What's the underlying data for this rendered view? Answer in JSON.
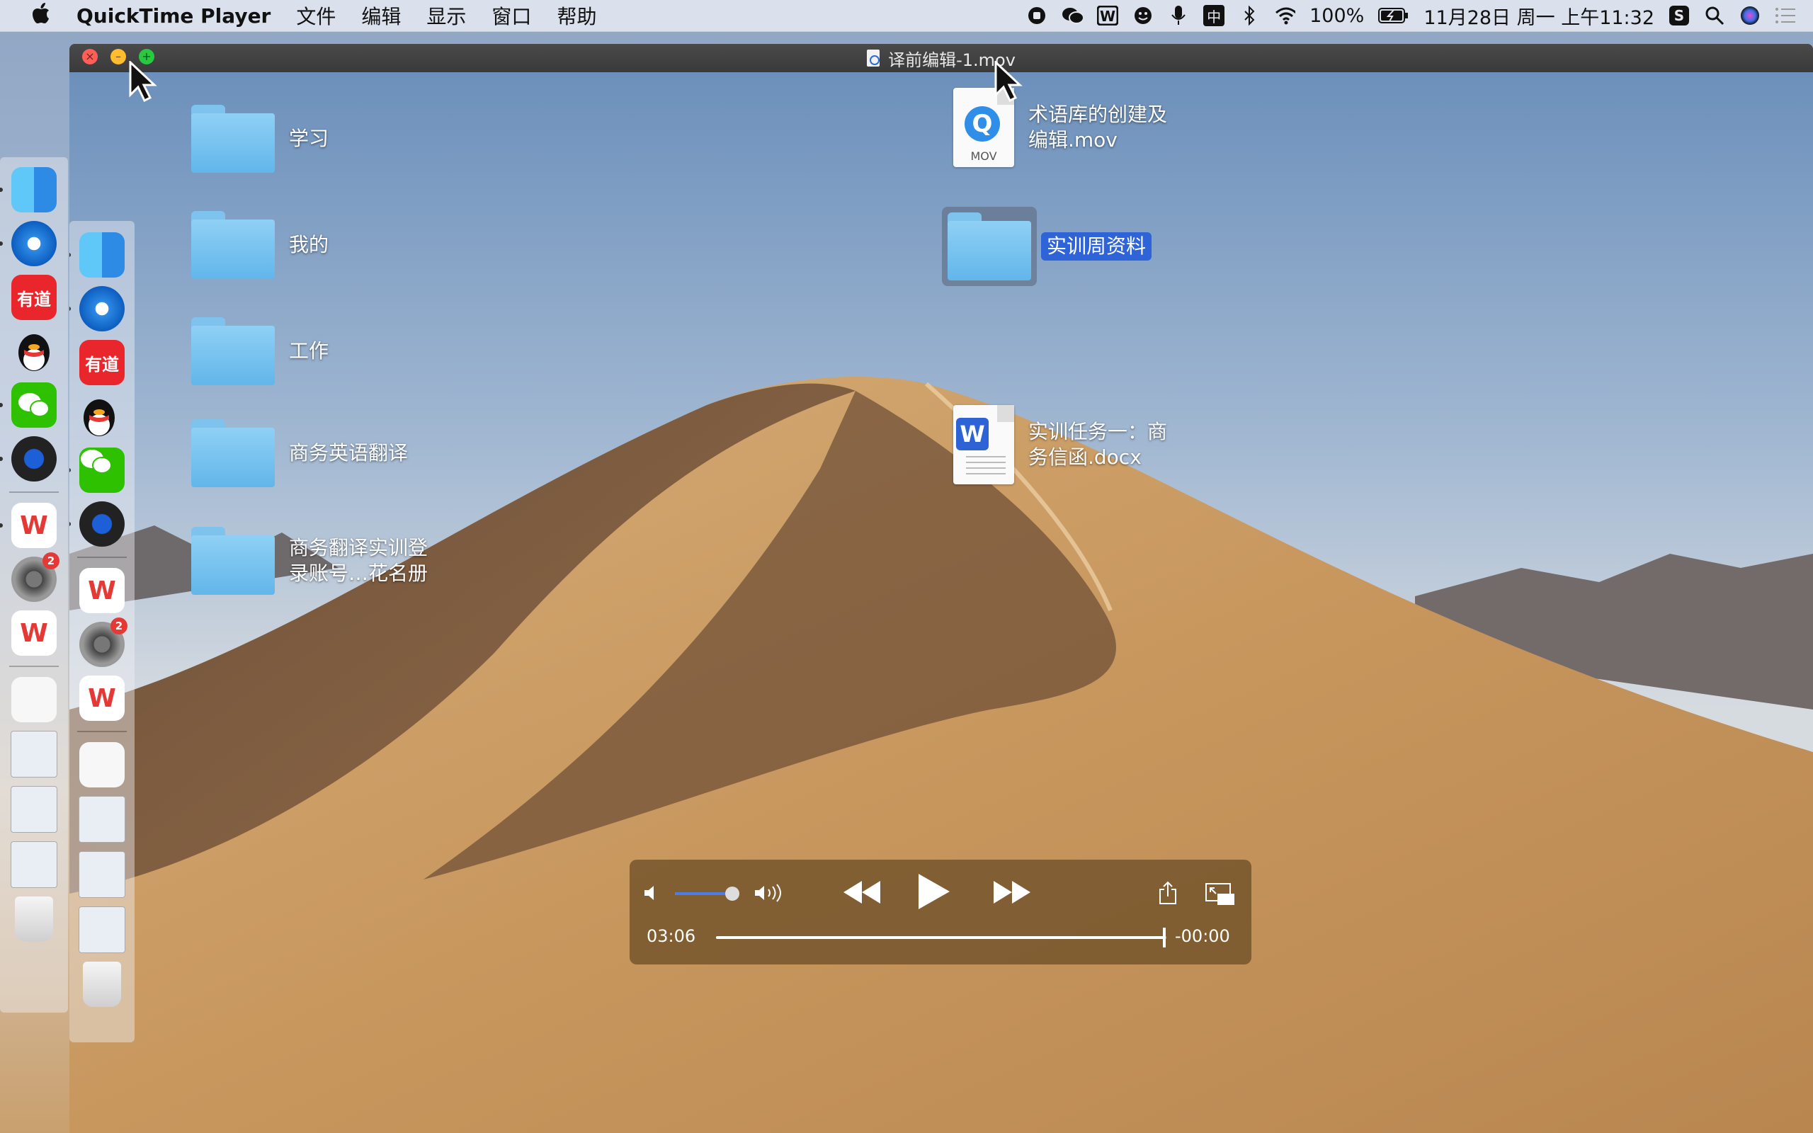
{
  "menubar": {
    "app_name": "QuickTime Player",
    "menus": [
      "文件",
      "编辑",
      "显示",
      "窗口",
      "帮助"
    ],
    "battery": "100%",
    "clock": "11月28日 周一 上午11:32",
    "status_icons": [
      "screen-record-icon",
      "wechat-icon",
      "wps-icon",
      "face-icon",
      "microphone-icon",
      "input-method-icon",
      "bluetooth-icon",
      "wifi-icon",
      "battery-icon",
      "sogou-icon",
      "spotlight-icon",
      "siri-icon",
      "notification-center-icon"
    ],
    "input_method": "中"
  },
  "window": {
    "title": "译前编辑-1.mov"
  },
  "desktop": {
    "folders_left": [
      "学习",
      "我的",
      "工作",
      "商务英语翻译",
      "商务翻译实训登录账号…花名册"
    ],
    "files_right": [
      {
        "name": "术语库的创建及编辑.mov",
        "icon": "quicktime-movie-icon",
        "ext": "MOV"
      },
      {
        "name": "实训周资料",
        "icon": "folder-icon",
        "selected": true
      },
      {
        "name": "实训任务一：商务信函.docx",
        "icon": "wps-document-icon",
        "glyph": "W"
      }
    ]
  },
  "dock_outer": {
    "apps": [
      {
        "name": "finder-icon",
        "running": true
      },
      {
        "name": "safari-icon",
        "running": true
      },
      {
        "name": "youdao-icon",
        "text": "有道",
        "running": false
      },
      {
        "name": "qq-icon",
        "running": false
      },
      {
        "name": "wechat-icon",
        "running": true
      },
      {
        "name": "quicktime-icon",
        "running": true
      },
      {
        "name": "wps-icon",
        "running": true
      },
      {
        "name": "system-preferences-icon",
        "badge": "2",
        "running": false
      },
      {
        "name": "wps-icon-2",
        "running": false
      }
    ]
  },
  "dock_inner": {
    "apps": [
      {
        "name": "finder-icon",
        "running": true
      },
      {
        "name": "safari-icon",
        "running": true
      },
      {
        "name": "youdao-icon",
        "text": "有道",
        "running": false
      },
      {
        "name": "qq-icon",
        "running": false
      },
      {
        "name": "wechat-icon",
        "running": true
      },
      {
        "name": "quicktime-icon",
        "running": true
      },
      {
        "name": "wps-icon",
        "running": true
      },
      {
        "name": "system-preferences-icon",
        "badge": "2",
        "running": false
      },
      {
        "name": "wps-icon-2",
        "running": false
      }
    ]
  },
  "player": {
    "elapsed": "03:06",
    "remaining": "-00:00",
    "volume": 0.9,
    "progress": 0.995,
    "buttons": {
      "mute": "speaker-low-icon",
      "volume_up": "speaker-high-icon",
      "rewind": "rewind-icon",
      "play": "play-icon",
      "fast_forward": "fast-forward-icon",
      "share": "share-icon",
      "pip": "picture-in-picture-icon"
    }
  },
  "colors": {
    "selection": "#2f63d8",
    "folder": "#62b6ea",
    "controls_bg": "#6e5028"
  }
}
